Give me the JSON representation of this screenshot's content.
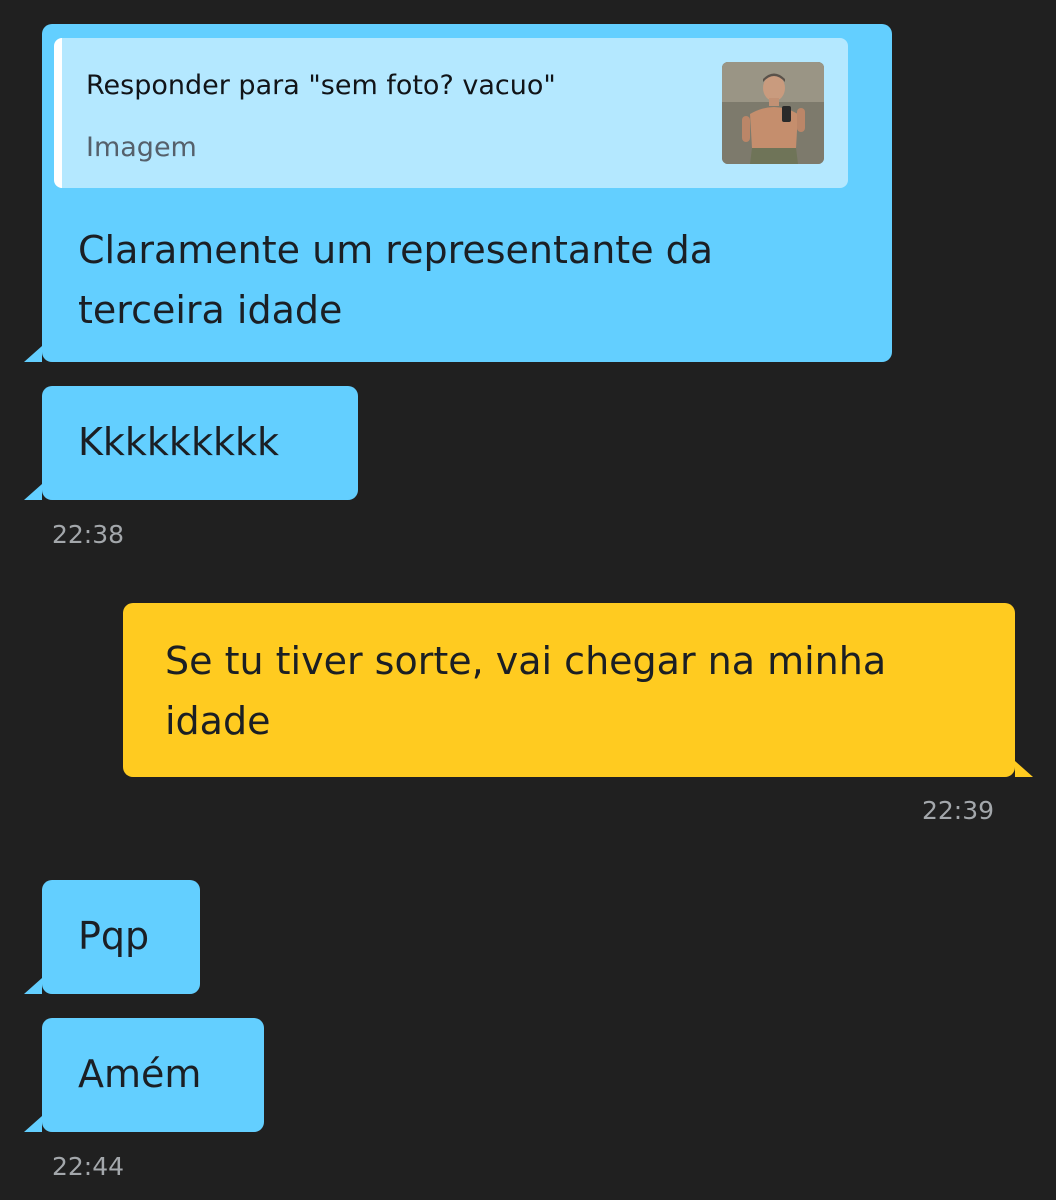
{
  "messages": {
    "m1": {
      "reply_title": "Responder para \"sem foto? vacuo\"",
      "reply_sub": "Imagem",
      "reply_thumb_icon": "photo-thumbnail",
      "text": "Claramente um representante da terceira idade"
    },
    "m2": {
      "text": "Kkkkkkkkk"
    },
    "t1": "22:38",
    "m3": {
      "text": "Se tu tiver sorte, vai chegar na minha idade"
    },
    "t2": "22:39",
    "m4": {
      "text": "Pqp"
    },
    "m5": {
      "text": "Amém"
    },
    "t3": "22:44"
  },
  "colors": {
    "background": "#202020",
    "incoming_bubble": "#63cfff",
    "outgoing_bubble": "#ffcb20",
    "reply_box": "#b4e8ff",
    "timestamp": "#a3a7ab"
  }
}
